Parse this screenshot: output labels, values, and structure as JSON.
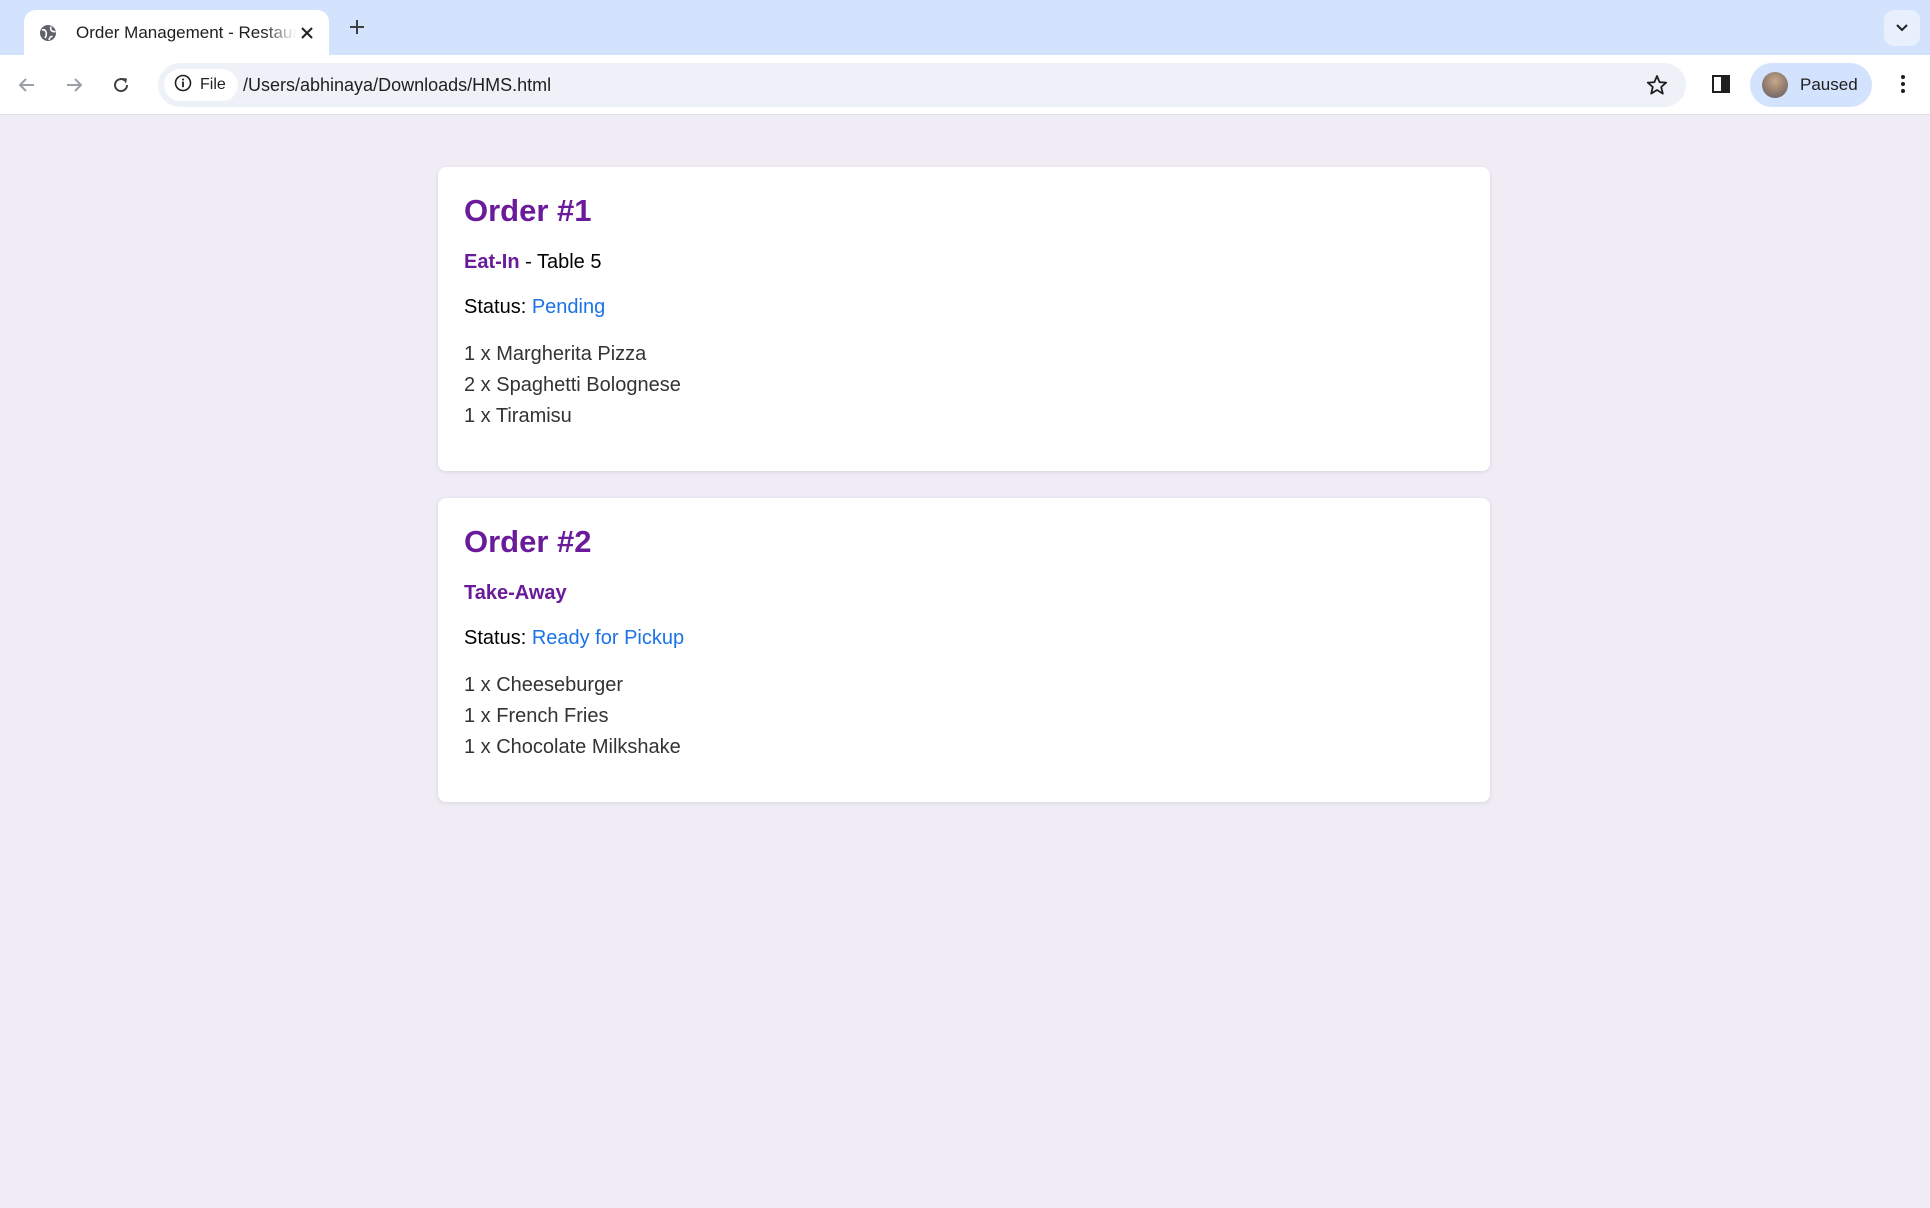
{
  "browser": {
    "tab": {
      "title": "Order Management - Restaurant",
      "favicon": "globe-icon"
    },
    "new_tab_icon": "plus-icon",
    "tab_search_icon": "chevron-down-icon",
    "site_chip_label": "File",
    "url": "/Users/abhinaya/Downloads/HMS.html",
    "profile_label": "Paused"
  },
  "colors": {
    "accent": "#6a1b9a",
    "status": "#1a73e8",
    "page_bg": "#efecf6",
    "tabstrip_bg": "#d3e3fd"
  },
  "orders": [
    {
      "title": "Order #1",
      "type": "Eat-In",
      "table": " - Table 5",
      "status_label": "Status: ",
      "status": "Pending",
      "items": [
        "1 x Margherita Pizza",
        "2 x Spaghetti Bolognese",
        "1 x Tiramisu"
      ]
    },
    {
      "title": "Order #2",
      "type": "Take-Away",
      "table": "",
      "status_label": "Status: ",
      "status": "Ready for Pickup",
      "items": [
        "1 x Cheeseburger",
        "1 x French Fries",
        "1 x Chocolate Milkshake"
      ]
    }
  ]
}
